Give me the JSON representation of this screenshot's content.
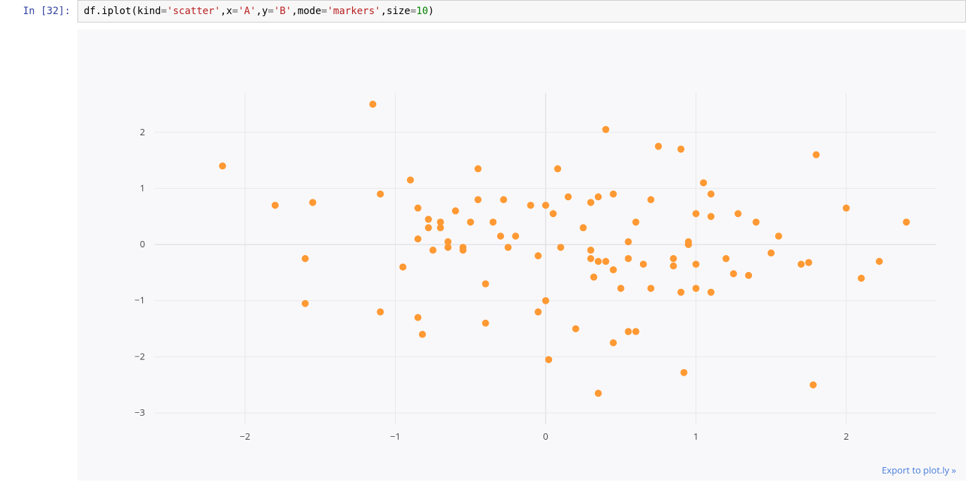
{
  "cell": {
    "prompt_prefix": "In [",
    "exec_count": "32",
    "prompt_suffix": "]:",
    "code_tokens": [
      {
        "t": "df",
        "c": "n"
      },
      {
        "t": ".",
        "c": "p"
      },
      {
        "t": "iplot",
        "c": "n"
      },
      {
        "t": "(",
        "c": "p"
      },
      {
        "t": "kind",
        "c": "n"
      },
      {
        "t": "=",
        "c": "o"
      },
      {
        "t": "'scatter'",
        "c": "s"
      },
      {
        "t": ",",
        "c": "p"
      },
      {
        "t": "x",
        "c": "n"
      },
      {
        "t": "=",
        "c": "o"
      },
      {
        "t": "'A'",
        "c": "s"
      },
      {
        "t": ",",
        "c": "p"
      },
      {
        "t": "y",
        "c": "n"
      },
      {
        "t": "=",
        "c": "o"
      },
      {
        "t": "'B'",
        "c": "s"
      },
      {
        "t": ",",
        "c": "p"
      },
      {
        "t": "mode",
        "c": "n"
      },
      {
        "t": "=",
        "c": "o"
      },
      {
        "t": "'markers'",
        "c": "s"
      },
      {
        "t": ",",
        "c": "p"
      },
      {
        "t": "size",
        "c": "n"
      },
      {
        "t": "=",
        "c": "o"
      },
      {
        "t": "10",
        "c": "m"
      },
      {
        "t": ")",
        "c": "p"
      }
    ]
  },
  "export_link_text": "Export to plot.ly »",
  "chart_data": {
    "type": "scatter",
    "xlabel": "",
    "ylabel": "",
    "xlim": [
      -2.6,
      2.6
    ],
    "ylim": [
      -3.2,
      2.7
    ],
    "x_ticks": [
      -2,
      -1,
      0,
      1,
      2
    ],
    "y_ticks": [
      -3,
      -2,
      -1,
      0,
      1,
      2
    ],
    "marker_color": "#ff9933",
    "marker_size": 10,
    "points": [
      {
        "x": -2.15,
        "y": 1.4
      },
      {
        "x": -1.8,
        "y": 0.7
      },
      {
        "x": -1.55,
        "y": 0.75
      },
      {
        "x": -1.6,
        "y": -0.25
      },
      {
        "x": -1.6,
        "y": -1.05
      },
      {
        "x": -1.15,
        "y": 2.5
      },
      {
        "x": -1.1,
        "y": 0.9
      },
      {
        "x": -1.1,
        "y": -1.2
      },
      {
        "x": -0.95,
        "y": -0.4
      },
      {
        "x": -0.9,
        "y": 1.15
      },
      {
        "x": -0.85,
        "y": 0.65
      },
      {
        "x": -0.85,
        "y": 0.1
      },
      {
        "x": -0.85,
        "y": -1.3
      },
      {
        "x": -0.82,
        "y": -1.6
      },
      {
        "x": -0.78,
        "y": 0.45
      },
      {
        "x": -0.78,
        "y": 0.3
      },
      {
        "x": -0.75,
        "y": -0.1
      },
      {
        "x": -0.7,
        "y": 0.4
      },
      {
        "x": -0.7,
        "y": 0.3
      },
      {
        "x": -0.65,
        "y": 0.05
      },
      {
        "x": -0.65,
        "y": -0.05
      },
      {
        "x": -0.6,
        "y": 0.6
      },
      {
        "x": -0.55,
        "y": -0.05
      },
      {
        "x": -0.55,
        "y": -0.1
      },
      {
        "x": -0.5,
        "y": 0.4
      },
      {
        "x": -0.45,
        "y": 1.35
      },
      {
        "x": -0.45,
        "y": 0.8
      },
      {
        "x": -0.4,
        "y": -0.7
      },
      {
        "x": -0.4,
        "y": -1.4
      },
      {
        "x": -0.35,
        "y": 0.4
      },
      {
        "x": -0.3,
        "y": 0.15
      },
      {
        "x": -0.28,
        "y": 0.8
      },
      {
        "x": -0.25,
        "y": -0.05
      },
      {
        "x": -0.2,
        "y": 0.15
      },
      {
        "x": -0.1,
        "y": 0.7
      },
      {
        "x": -0.05,
        "y": -0.2
      },
      {
        "x": -0.05,
        "y": -1.2
      },
      {
        "x": 0.0,
        "y": 0.7
      },
      {
        "x": 0.0,
        "y": -1.0
      },
      {
        "x": 0.02,
        "y": -2.05
      },
      {
        "x": 0.05,
        "y": 0.55
      },
      {
        "x": 0.08,
        "y": 1.35
      },
      {
        "x": 0.1,
        "y": -0.05
      },
      {
        "x": 0.15,
        "y": 0.85
      },
      {
        "x": 0.2,
        "y": -1.5
      },
      {
        "x": 0.25,
        "y": 0.3
      },
      {
        "x": 0.3,
        "y": 0.75
      },
      {
        "x": 0.3,
        "y": -0.1
      },
      {
        "x": 0.3,
        "y": -0.25
      },
      {
        "x": 0.32,
        "y": -0.58
      },
      {
        "x": 0.35,
        "y": 0.85
      },
      {
        "x": 0.35,
        "y": -0.3
      },
      {
        "x": 0.35,
        "y": -2.65
      },
      {
        "x": 0.4,
        "y": 2.05
      },
      {
        "x": 0.4,
        "y": -0.3
      },
      {
        "x": 0.45,
        "y": 0.9
      },
      {
        "x": 0.45,
        "y": -0.45
      },
      {
        "x": 0.45,
        "y": -1.75
      },
      {
        "x": 0.5,
        "y": -0.78
      },
      {
        "x": 0.55,
        "y": 0.05
      },
      {
        "x": 0.55,
        "y": -0.25
      },
      {
        "x": 0.55,
        "y": -1.55
      },
      {
        "x": 0.6,
        "y": 0.4
      },
      {
        "x": 0.6,
        "y": -1.55
      },
      {
        "x": 0.65,
        "y": -0.35
      },
      {
        "x": 0.7,
        "y": 0.8
      },
      {
        "x": 0.7,
        "y": -0.78
      },
      {
        "x": 0.75,
        "y": 1.75
      },
      {
        "x": 0.85,
        "y": -0.25
      },
      {
        "x": 0.85,
        "y": -0.38
      },
      {
        "x": 0.9,
        "y": 1.7
      },
      {
        "x": 0.9,
        "y": -0.85
      },
      {
        "x": 0.92,
        "y": -2.28
      },
      {
        "x": 0.95,
        "y": 0.0
      },
      {
        "x": 0.95,
        "y": 0.05
      },
      {
        "x": 1.0,
        "y": 0.55
      },
      {
        "x": 1.0,
        "y": -0.35
      },
      {
        "x": 1.0,
        "y": -0.78
      },
      {
        "x": 1.05,
        "y": 1.1
      },
      {
        "x": 1.1,
        "y": 0.9
      },
      {
        "x": 1.1,
        "y": 0.5
      },
      {
        "x": 1.1,
        "y": -0.85
      },
      {
        "x": 1.2,
        "y": -0.25
      },
      {
        "x": 1.25,
        "y": -0.52
      },
      {
        "x": 1.28,
        "y": 0.55
      },
      {
        "x": 1.35,
        "y": -0.55
      },
      {
        "x": 1.4,
        "y": 0.4
      },
      {
        "x": 1.5,
        "y": -0.15
      },
      {
        "x": 1.55,
        "y": 0.15
      },
      {
        "x": 1.7,
        "y": -0.35
      },
      {
        "x": 1.75,
        "y": -0.32
      },
      {
        "x": 1.78,
        "y": -2.5
      },
      {
        "x": 1.8,
        "y": 1.6
      },
      {
        "x": 2.0,
        "y": 0.65
      },
      {
        "x": 2.1,
        "y": -0.6
      },
      {
        "x": 2.22,
        "y": -0.3
      },
      {
        "x": 2.4,
        "y": 0.4
      }
    ]
  }
}
